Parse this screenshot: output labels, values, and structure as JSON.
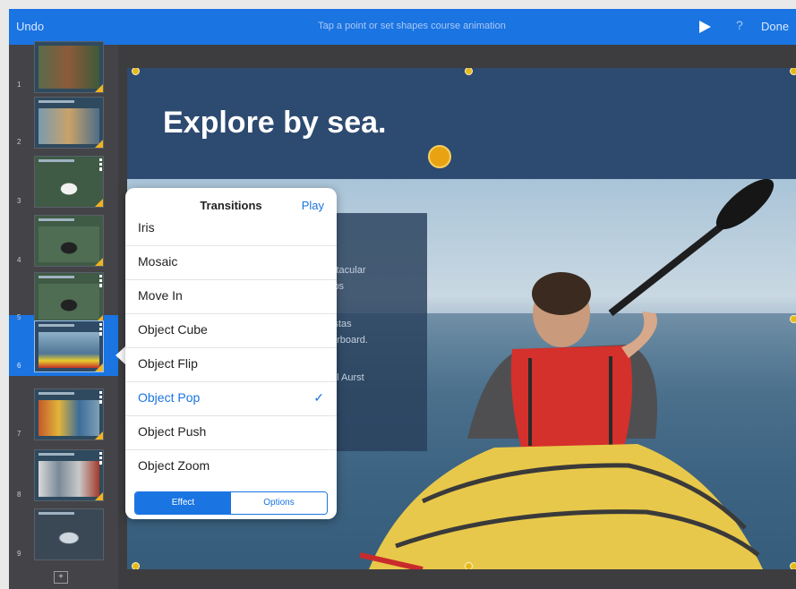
{
  "toolbar": {
    "undo_label": "Undo",
    "hint": "Tap a point or set shapes course animation",
    "help_glyph": "?",
    "done_label": "Done",
    "play_icon": "play-icon"
  },
  "navigator": {
    "slide_numbers": [
      "1",
      "2",
      "3",
      "4",
      "5",
      "6",
      "7",
      "8",
      "9"
    ],
    "selected_index": 6,
    "add_slide_glyph": "+"
  },
  "slide": {
    "title": "Explore by sea.",
    "panel_lines": [
      "ctacular",
      "ips",
      "istas",
      "erboard.",
      "ul Aurst"
    ]
  },
  "transitions": {
    "title": "Transitions",
    "play_label": "Play",
    "items": [
      "Iris",
      "Mosaic",
      "Move In",
      "Object Cube",
      "Object Flip",
      "Object Pop",
      "Object Push",
      "Object Zoom"
    ],
    "selected": "Object Pop",
    "check_glyph": "✓",
    "segments": [
      "Effect",
      "Options"
    ],
    "active_segment": "Effect"
  },
  "colors": {
    "accent": "#1a74e2",
    "handle": "#e6b91a",
    "slide_header": "#2d4a70"
  }
}
